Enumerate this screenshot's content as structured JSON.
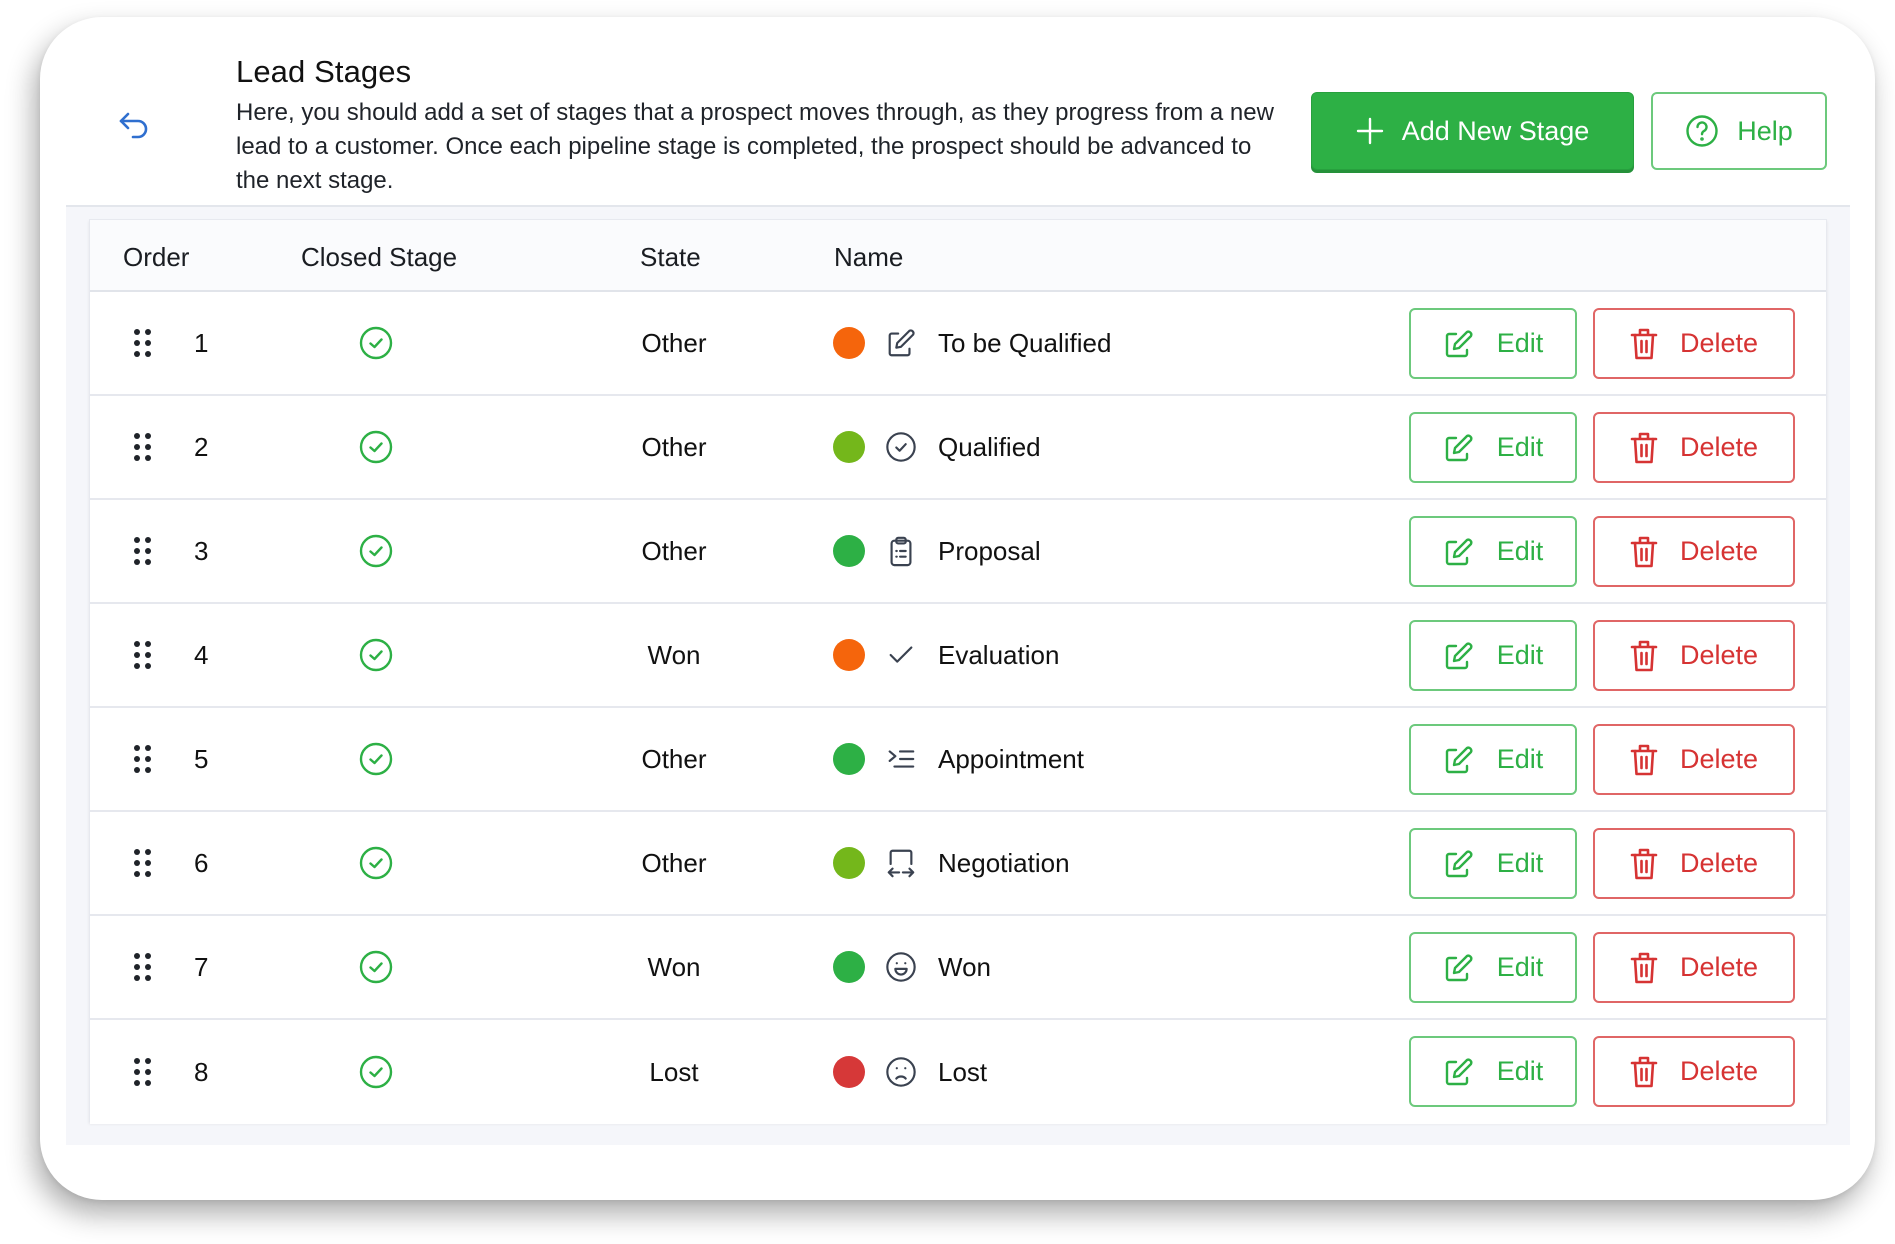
{
  "header": {
    "title": "Lead Stages",
    "description": "Here, you should add a set of stages that a prospect moves through, as they progress from a new lead to a customer. Once each pipeline stage is completed, the prospect should be advanced to the next stage.",
    "back_icon": "undo-arrow-icon",
    "add_button": {
      "label": "Add New Stage",
      "icon": "plus-icon"
    },
    "help_button": {
      "label": "Help",
      "icon": "question-circle-icon"
    }
  },
  "colors": {
    "primary_green": "#2db045",
    "danger_red": "#d63333",
    "back_blue": "#2f6fcf",
    "orange": "#f5650c",
    "lime": "#74b71b",
    "green": "#2db045",
    "red": "#d63838"
  },
  "table": {
    "columns": [
      "Order",
      "Closed Stage",
      "State",
      "Name"
    ],
    "edit_label": "Edit",
    "delete_label": "Delete",
    "rows": [
      {
        "order": "1",
        "closed": true,
        "state": "Other",
        "color": "#f5650c",
        "icon": "edit-pencil-icon",
        "name": "To be Qualified"
      },
      {
        "order": "2",
        "closed": true,
        "state": "Other",
        "color": "#74b71b",
        "icon": "check-circle-icon",
        "name": "Qualified"
      },
      {
        "order": "3",
        "closed": true,
        "state": "Other",
        "color": "#2db045",
        "icon": "clipboard-list-icon",
        "name": "Proposal"
      },
      {
        "order": "4",
        "closed": true,
        "state": "Won",
        "color": "#f5650c",
        "icon": "check-icon",
        "name": "Evaluation"
      },
      {
        "order": "5",
        "closed": true,
        "state": "Other",
        "color": "#2db045",
        "icon": "list-indent-icon",
        "name": "Appointment"
      },
      {
        "order": "6",
        "closed": true,
        "state": "Other",
        "color": "#74b71b",
        "icon": "swap-frame-icon",
        "name": "Negotiation"
      },
      {
        "order": "7",
        "closed": true,
        "state": "Won",
        "color": "#2db045",
        "icon": "smile-icon",
        "name": "Won"
      },
      {
        "order": "8",
        "closed": true,
        "state": "Lost",
        "color": "#d63838",
        "icon": "frown-icon",
        "name": "Lost"
      }
    ]
  }
}
